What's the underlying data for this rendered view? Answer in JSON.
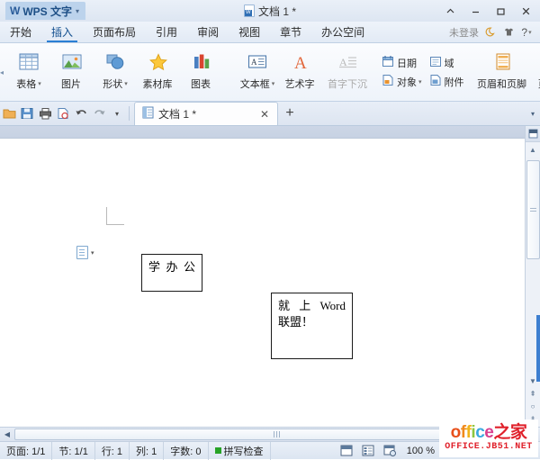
{
  "titlebar": {
    "app_logo": "W",
    "app_name": "WPS 文字",
    "app_caret": "▾",
    "document_title": "文档 1 *",
    "buttons": [
      {
        "name": "collapse-ribbon-button",
        "label": "^"
      },
      {
        "name": "minimize-button",
        "label": "—"
      },
      {
        "name": "maximize-button",
        "label": "▢"
      },
      {
        "name": "close-button",
        "label": "✕"
      }
    ]
  },
  "tabs": {
    "items": [
      {
        "label": "开始",
        "active": false
      },
      {
        "label": "插入",
        "active": true
      },
      {
        "label": "页面布局",
        "active": false
      },
      {
        "label": "引用",
        "active": false
      },
      {
        "label": "审阅",
        "active": false
      },
      {
        "label": "视图",
        "active": false
      },
      {
        "label": "章节",
        "active": false
      },
      {
        "label": "办公空间",
        "active": false
      }
    ],
    "login_text": "未登录",
    "help_label": "?",
    "help_caret": "▾"
  },
  "ribbon": {
    "group1": [
      {
        "label": "表格",
        "icon": "table-icon",
        "caret": "▾"
      },
      {
        "label": "图片",
        "icon": "picture-icon",
        "caret": ""
      },
      {
        "label": "形状",
        "icon": "shapes-icon",
        "caret": "▾"
      },
      {
        "label": "素材库",
        "icon": "material-library-icon",
        "caret": ""
      },
      {
        "label": "图表",
        "icon": "chart-icon",
        "caret": ""
      }
    ],
    "group2": [
      {
        "label": "文本框",
        "icon": "textbox-icon",
        "caret": "▾",
        "dim": false
      },
      {
        "label": "艺术字",
        "icon": "wordart-icon",
        "caret": "",
        "dim": false
      },
      {
        "label": "首字下沉",
        "icon": "dropcap-icon",
        "caret": "",
        "dim": true
      }
    ],
    "group3": [
      {
        "label": "日期",
        "icon": "date-icon",
        "caret": ""
      },
      {
        "label": "域",
        "icon": "field-icon",
        "caret": ""
      },
      {
        "label": "对象",
        "icon": "object-icon",
        "caret": "▾"
      },
      {
        "label": "附件",
        "icon": "attachment-icon",
        "caret": ""
      }
    ],
    "group4": [
      {
        "label": "页眉和页脚",
        "icon": "header-footer-icon",
        "caret": ""
      },
      {
        "label": "页码",
        "icon": "page-number-icon",
        "caret": "▾"
      }
    ],
    "edge_left": "◂",
    "edge_right": "▸"
  },
  "quickbar": {
    "icons": [
      {
        "name": "open-icon"
      },
      {
        "name": "save-icon"
      },
      {
        "name": "print-icon"
      },
      {
        "name": "print-preview-icon"
      },
      {
        "name": "undo-icon"
      },
      {
        "name": "redo-icon"
      }
    ],
    "dropdown_caret": "▾",
    "doc_tab_label": "文档 1 *",
    "doc_tab_close": "✕",
    "new_tab": "+",
    "right_caret": "▾"
  },
  "document": {
    "textbox1": {
      "lines": [
        [
          "学",
          "办",
          "公"
        ]
      ]
    },
    "textbox2": {
      "line1": [
        "就",
        "上",
        "Word"
      ],
      "line2": "联盟！"
    }
  },
  "statusbar": {
    "page": "页面: 1/1",
    "section": "节: 1/1",
    "row": "行: 1",
    "column": "列: 1",
    "words": "字数: 0",
    "spellcheck": "拼写检查",
    "zoom": "100 %",
    "zoom_minus": "—",
    "zoom_plus": "+",
    "views": [
      {
        "name": "page-view-button"
      },
      {
        "name": "outline-view-button"
      },
      {
        "name": "web-view-button"
      }
    ]
  },
  "watermark": {
    "text_parts": [
      "o",
      "f",
      "f",
      "i",
      "c",
      "e"
    ],
    "text_cn": "之家",
    "url": "OFFICE.JB51.NET"
  },
  "colors": {
    "accent": "#2b7fd4",
    "titlebar_bg": "#e4ecf6",
    "ribbon_bg": "#f3f7fc",
    "scroll_blue": "#3d7fd0",
    "spell_green": "#27a327"
  }
}
